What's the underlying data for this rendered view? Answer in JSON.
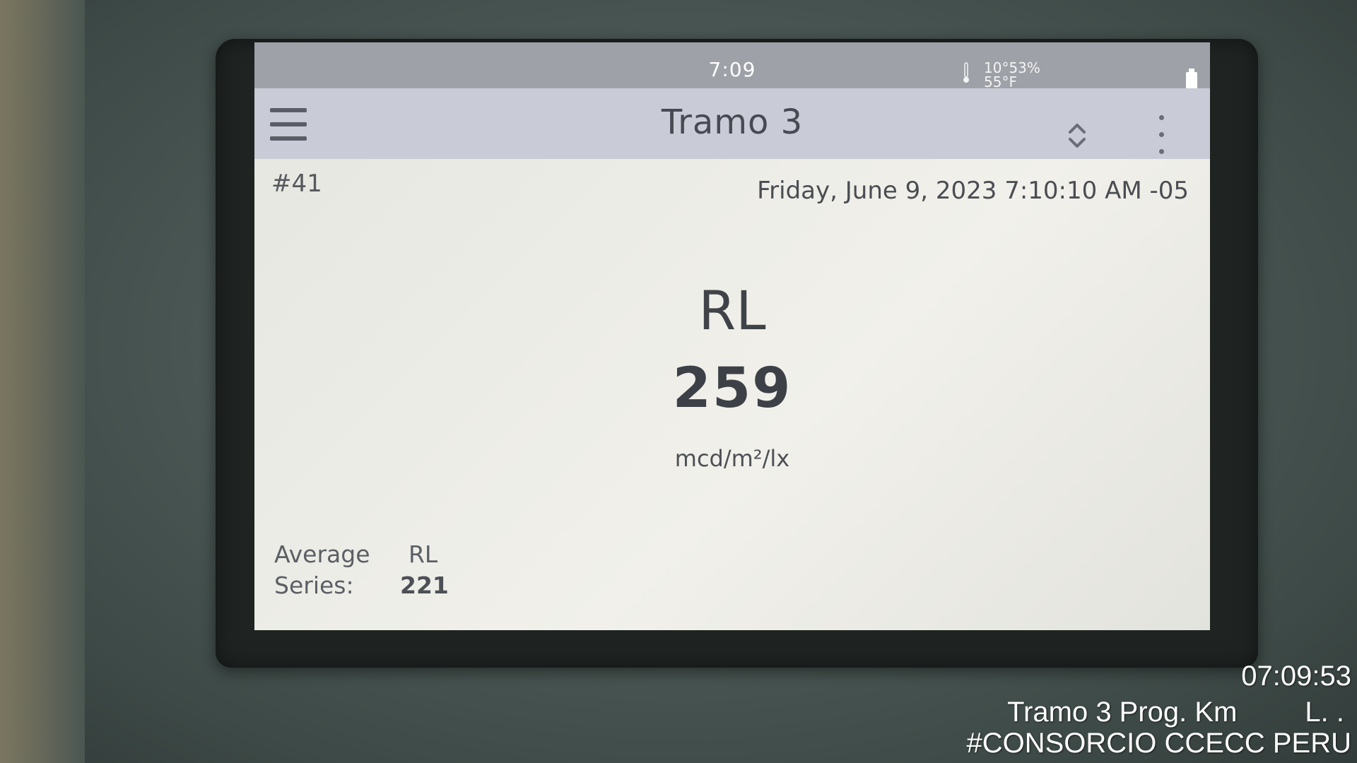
{
  "status_bar": {
    "time": "7:09",
    "humidity": "53%",
    "temperature": "55°F",
    "temperature_prefix": "10°",
    "icons": [
      "thermometer-icon",
      "battery-icon"
    ]
  },
  "app_bar": {
    "title": "Tramo 3",
    "icons": [
      "menu-icon",
      "sort-icon",
      "more-vert-icon"
    ]
  },
  "record": {
    "id": "#41",
    "timestamp": "Friday, June 9, 2023 7:10:10 AM -05"
  },
  "measurement": {
    "label": "RL",
    "value": "259",
    "unit": "mcd/m²/lx"
  },
  "average_series": {
    "label_line1": "Average",
    "label_line2": "Series:",
    "header": "RL",
    "value": "221"
  },
  "watermark": {
    "time": "07:09:53",
    "line1_left": "Tramo 3 Prog. Km",
    "line1_right": "L.   .",
    "line2": "#CONSORCIO CCECC PERU"
  },
  "colors": {
    "status_bar": "#9ea1a7",
    "app_bar": "#c9cbd6",
    "screen_bg": "#ecece6",
    "text_dark": "#3f4247"
  }
}
